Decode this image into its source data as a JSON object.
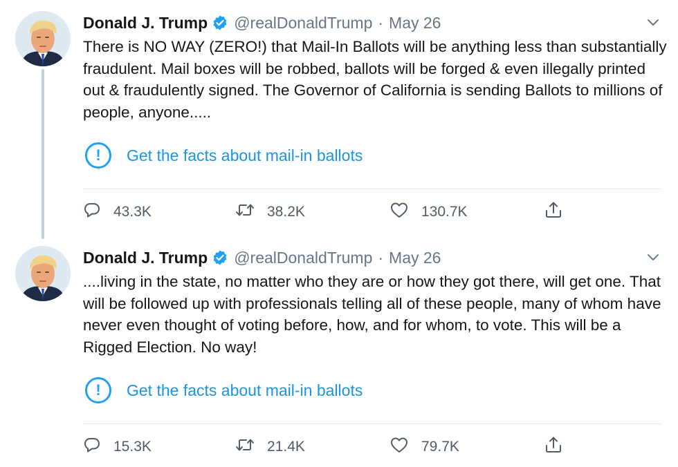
{
  "tweets": [
    {
      "author_name": "Donald J. Trump",
      "handle": "@realDonaldTrump",
      "separator": "·",
      "date": "May 26",
      "text": "There is NO WAY (ZERO!) that Mail-In Ballots will be anything less than substantially fraudulent. Mail boxes will be robbed, ballots will be forged & even illegally printed out & fraudulently signed. The Governor of California is sending Ballots to millions of people, anyone.....",
      "fact_check_label": "Get the facts about mail-in ballots",
      "fact_check_icon_glyph": "!",
      "replies": "43.3K",
      "retweets": "38.2K",
      "likes": "130.7K"
    },
    {
      "author_name": "Donald J. Trump",
      "handle": "@realDonaldTrump",
      "separator": "·",
      "date": "May 26",
      "text": "....living in the state, no matter who they are or how they got there, will get one. That will be followed up with professionals telling all of these people, many of whom have never even thought of voting before, how, and for whom, to vote. This will be a Rigged Election. No way!",
      "fact_check_label": "Get the facts about mail-in ballots",
      "fact_check_icon_glyph": "!",
      "replies": "15.3K",
      "retweets": "21.4K",
      "likes": "79.7K"
    }
  ],
  "icons": {
    "verified": "verified-badge-icon",
    "caret": "chevron-down-icon",
    "reply": "reply-icon",
    "retweet": "retweet-icon",
    "like": "heart-icon",
    "share": "share-icon",
    "fact_check": "exclamation-circle-icon"
  },
  "colors": {
    "accent": "#1da1f2",
    "link": "#1b95e0",
    "text": "#14171a",
    "secondary": "#657786",
    "divider": "#e1e8ed",
    "thread_line": "#c4cfd6"
  }
}
